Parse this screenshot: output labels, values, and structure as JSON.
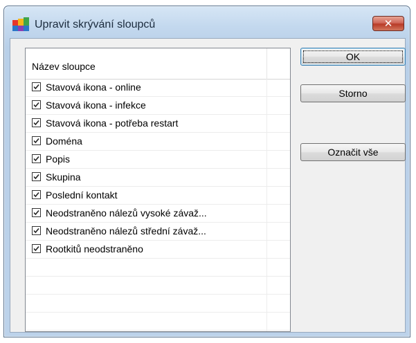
{
  "window": {
    "title": "Upravit skrývání sloupců",
    "close_glyph": "✕"
  },
  "list": {
    "column_header": "Název sloupce",
    "items": [
      {
        "label": "Stavová ikona - online",
        "checked": true
      },
      {
        "label": "Stavová ikona - infekce",
        "checked": true
      },
      {
        "label": "Stavová ikona - potřeba restart",
        "checked": true
      },
      {
        "label": "Doména",
        "checked": true
      },
      {
        "label": "Popis",
        "checked": true
      },
      {
        "label": "Skupina",
        "checked": true
      },
      {
        "label": "Poslední kontakt",
        "checked": true
      },
      {
        "label": "Neodstraněno nálezů vysoké závaž...",
        "checked": true
      },
      {
        "label": "Neodstraněno nálezů střední závaž...",
        "checked": true
      },
      {
        "label": "Rootkitů neodstraněno",
        "checked": true
      }
    ],
    "empty_rows": 4
  },
  "buttons": {
    "ok": "OK",
    "cancel": "Storno",
    "select_all": "Označit vše"
  },
  "colors": {
    "titlebar": "#c3d8ee",
    "close": "#c4503c"
  }
}
